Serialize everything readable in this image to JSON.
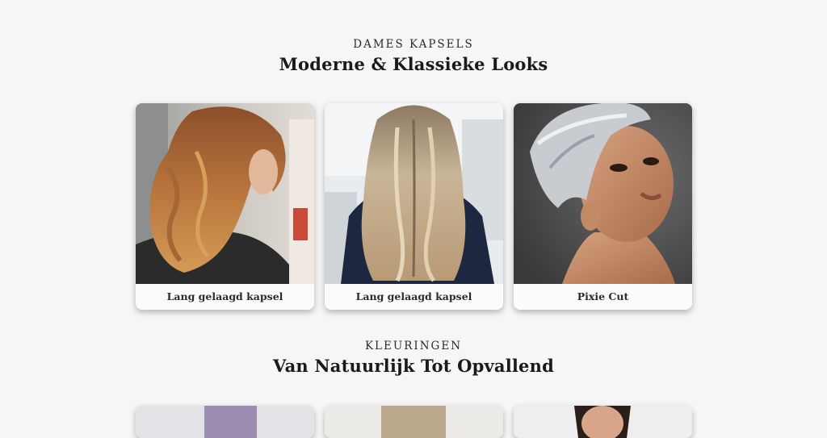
{
  "section1": {
    "eyebrow": "DAMES KAPSELS",
    "title": "Moderne & Klassieke Looks",
    "cards": [
      {
        "caption": "Lang gelaagd kapsel",
        "image": "woman-wavy-copper-hair-photo"
      },
      {
        "caption": "Lang gelaagd kapsel",
        "image": "woman-long-blonde-balayage-back-photo"
      },
      {
        "caption": "Pixie Cut",
        "image": "woman-silver-pixie-cut-portrait-photo"
      }
    ]
  },
  "section2": {
    "eyebrow": "KLEURINGEN",
    "title": "Van Natuurlijk Tot Opvallend",
    "cards": [
      {
        "image": "lavender-hair-photo"
      },
      {
        "image": "blonde-hair-photo"
      },
      {
        "image": "dark-hair-portrait-photo"
      }
    ]
  },
  "colors": {
    "background": "#f6f6f6",
    "card": "#fbfbfb",
    "text": "#1e1e1e"
  }
}
